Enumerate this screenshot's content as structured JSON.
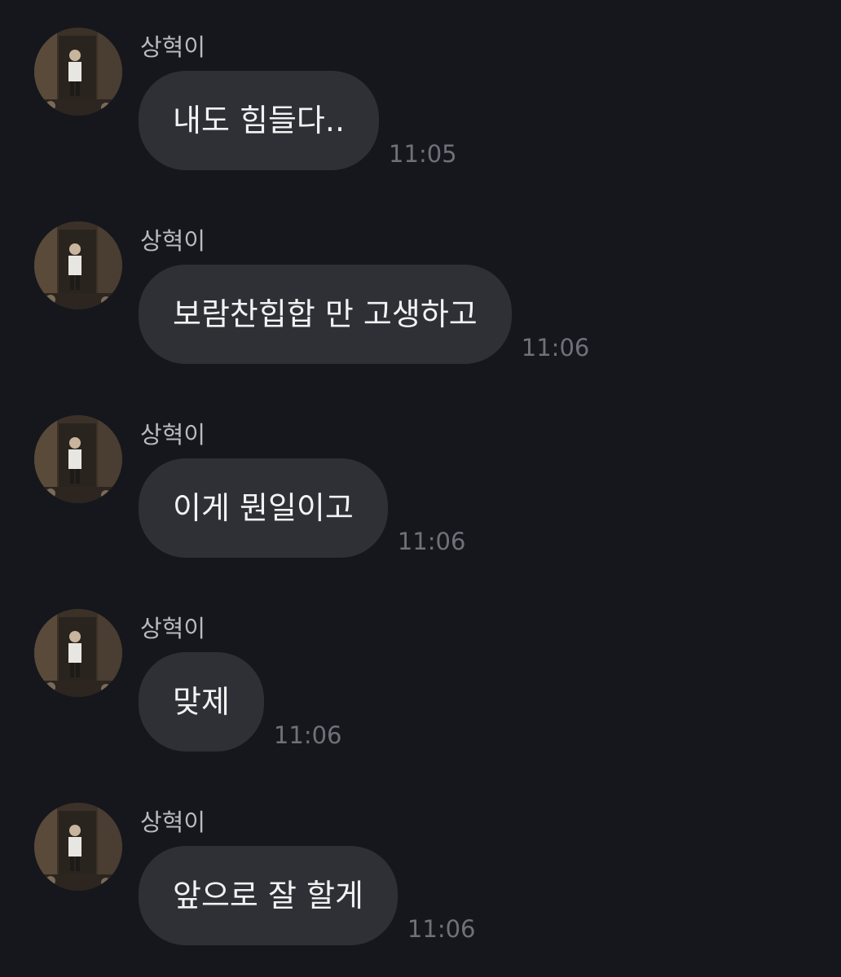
{
  "messages": [
    {
      "sender": "상혁이",
      "text": "내도 힘들다..",
      "time": "11:05"
    },
    {
      "sender": "상혁이",
      "text": "보람찬힙합 만 고생하고",
      "time": "11:06"
    },
    {
      "sender": "상혁이",
      "text": "이게 뭔일이고",
      "time": "11:06"
    },
    {
      "sender": "상혁이",
      "text": "맞제",
      "time": "11:06"
    },
    {
      "sender": "상혁이",
      "text": "앞으로 잘 할게",
      "time": "11:06"
    }
  ]
}
